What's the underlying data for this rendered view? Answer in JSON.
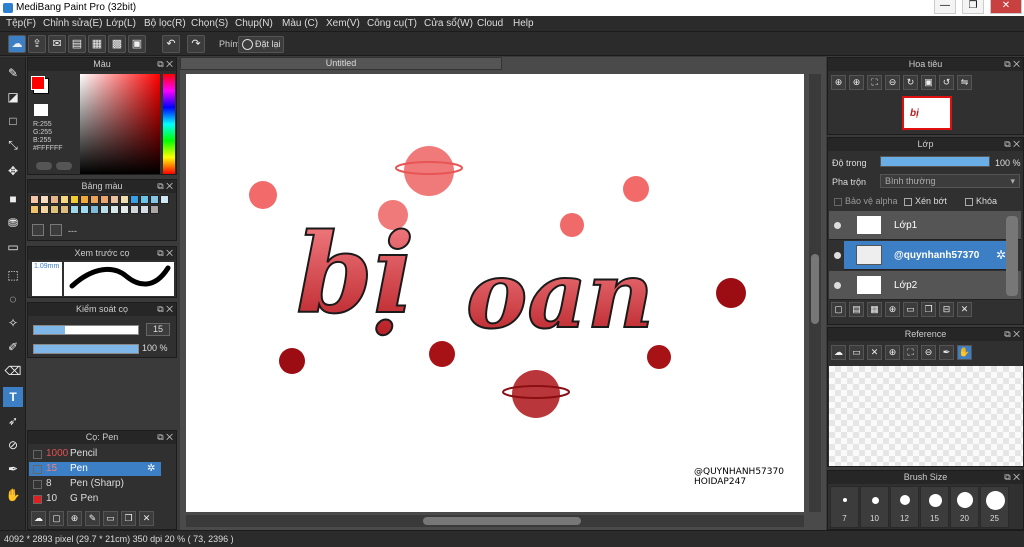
{
  "window": {
    "title": "MediBang Paint Pro (32bit)",
    "min": "—",
    "max": "❐",
    "close": "✕"
  },
  "menu": [
    "Tệp(F)",
    "Chỉnh sửa(E)",
    "Lớp(L)",
    "Bộ lọc(R)",
    "Chọn(S)",
    "Chụp(N)",
    "Màu (C)",
    "Xem(V)",
    "Công cụ(T)",
    "Cửa sổ(W)",
    "Cloud",
    "Help"
  ],
  "toolbar": {
    "key_label": "Phím",
    "reset_label": "Đặt lại"
  },
  "color_panel": {
    "title": "Màu",
    "r": "R:255",
    "g": "G:255",
    "b": "B:255",
    "hex": "#FFFFFF",
    "primary": "#ff0000",
    "secondary": "#ffffff"
  },
  "palette_panel": {
    "title": "Bảng màu",
    "dash": "---",
    "swatches": [
      "#f6c4a8",
      "#f6ddc2",
      "#e7b58c",
      "#f7d783",
      "#f2ca33",
      "#f2a83a",
      "#e9a35b",
      "#eba56f",
      "#eac2a0",
      "#f0ddaf",
      "#3aa0e6",
      "#6dc3e7",
      "#86c7e9",
      "#cfe8f3",
      "#f0c36b",
      "#f4d3a0",
      "#dfc27a",
      "#e0bb7f",
      "#a0d6e8",
      "#9edbf3",
      "#7db9d9",
      "#b9dee9",
      "#d7e7ea",
      "#e3e8e9",
      "#d0d5db",
      "#d6dde6",
      "#aaa7a5"
    ]
  },
  "brush_preview": {
    "title": "Xem trước cọ",
    "size": "1.09mm"
  },
  "brush_control": {
    "title": "Kiểm soát cọ",
    "size_value": "15",
    "opacity_value": "100 %",
    "size_fraction": 0.3,
    "opacity_fraction": 1.0
  },
  "brush_list": {
    "title": "Cọ: Pen",
    "items": [
      {
        "size": "1000",
        "name": "Pencil",
        "color": "#333333"
      },
      {
        "size": "15",
        "name": "Pen",
        "color": "#3d7fc4",
        "active": true
      },
      {
        "size": "8",
        "name": "Pen (Sharp)",
        "color": "#333333"
      },
      {
        "size": "10",
        "name": "G Pen",
        "color": "#e02020"
      }
    ]
  },
  "canvas": {
    "tab": "Untitled",
    "watermark_line1": "@QUYNHANH57370",
    "watermark_line2": "HOIDAP247",
    "text_line1": "bị",
    "text_line2": "oan"
  },
  "navigator": {
    "title": "Hoa tiêu"
  },
  "layers": {
    "title": "Lớp",
    "opacity_label": "Độ trong",
    "opacity_value": "100 %",
    "opacity_fraction": 1.0,
    "blend_label": "Pha trộn",
    "blend_value": "Bình thường",
    "protect_alpha": "Bảo vệ alpha",
    "clipping": "Xén bớt",
    "lock": "Khóa",
    "items": [
      {
        "name": "Lớp1",
        "active": false
      },
      {
        "name": "@quynhanh57370",
        "active": true
      },
      {
        "name": "Lớp2",
        "active": false
      }
    ]
  },
  "reference": {
    "title": "Reference"
  },
  "brush_size": {
    "title": "Brush Size",
    "sizes": [
      "7",
      "10",
      "12",
      "15",
      "20",
      "25"
    ]
  },
  "status": {
    "text": "4092 * 2893 pixel   (29.7 * 21cm)   350 dpi   20 %   ( 73, 2396 )"
  }
}
